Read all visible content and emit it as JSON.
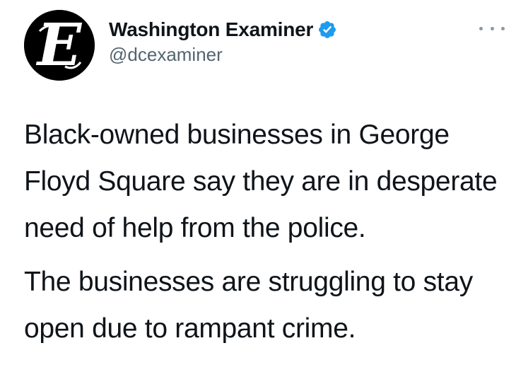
{
  "tweet": {
    "author": {
      "display_name": "Washington Examiner",
      "handle": "@dcexaminer",
      "avatar_letter": "E",
      "verified": true,
      "verified_color": "#1d9bf0"
    },
    "more_icon": "more-horizontal-icon",
    "paragraphs": [
      "Black-owned businesses in George Floyd Square say they are in desperate need of help from the police.",
      "The businesses are struggling to stay open due to rampant crime."
    ]
  }
}
